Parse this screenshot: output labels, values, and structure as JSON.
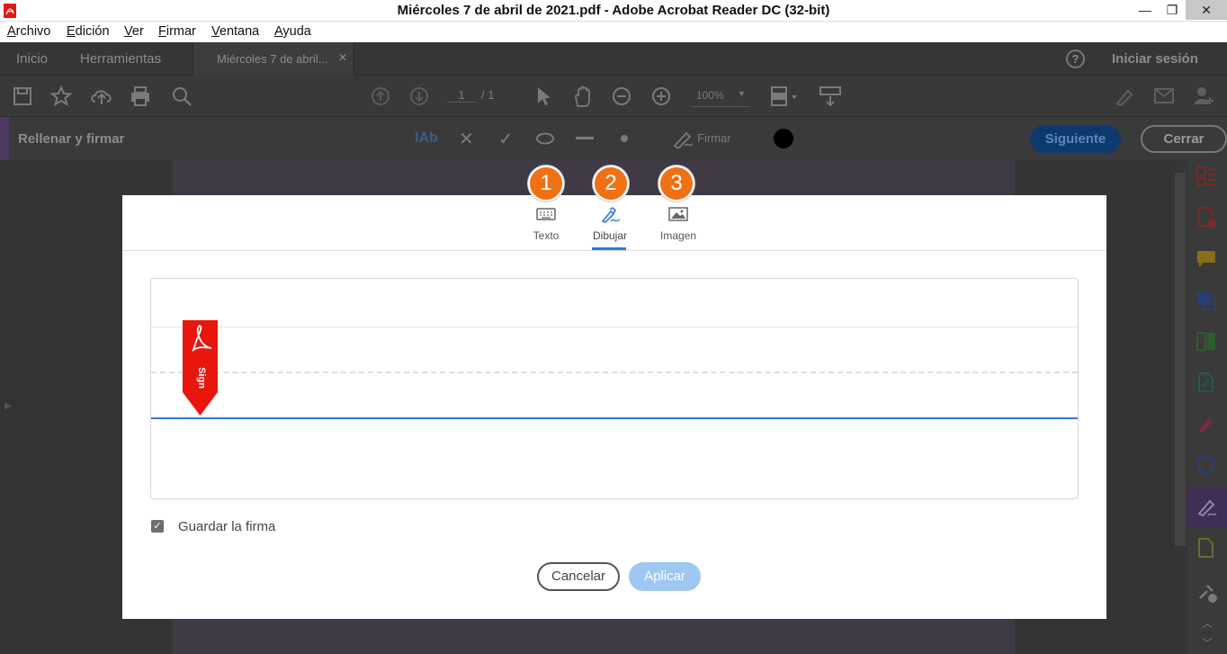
{
  "window": {
    "title": "Miércoles 7 de abril de 2021.pdf - Adobe Acrobat Reader DC (32-bit)",
    "minimize": "—",
    "maximize": "❐",
    "close": "✕"
  },
  "menu": [
    "Archivo",
    "Edición",
    "Ver",
    "Firmar",
    "Ventana",
    "Ayuda"
  ],
  "tabs": {
    "home": "Inicio",
    "tools": "Herramientas",
    "document": "Miércoles 7 de abril...",
    "document_close": "✕",
    "help": "?",
    "signin": "Iniciar sesión"
  },
  "toolbar": {
    "page_current": "1",
    "page_total": "/ 1",
    "zoom": "100%"
  },
  "fill_sign": {
    "title": "Rellenar y firmar",
    "text_tool": "IAb",
    "sign_label": "Firmar",
    "next": "Siguiente",
    "close": "Cerrar",
    "ink_color": "#000000"
  },
  "dialog": {
    "tabs": [
      {
        "label": "Texto",
        "badge": "1",
        "icon": "keyboard-icon"
      },
      {
        "label": "Dibujar",
        "badge": "2",
        "icon": "pen-draw-icon",
        "active": true
      },
      {
        "label": "Imagen",
        "badge": "3",
        "icon": "image-icon"
      }
    ],
    "sign_flag_text": "Sign",
    "save_signature": "Guardar la firma",
    "save_checked": true,
    "cancel": "Cancelar",
    "apply": "Aplicar"
  },
  "colors": {
    "accent": "#2d7ad4",
    "badge": "#f07114",
    "sign_flag": "#e8160c",
    "apply_disabled": "#9ec7f2"
  }
}
